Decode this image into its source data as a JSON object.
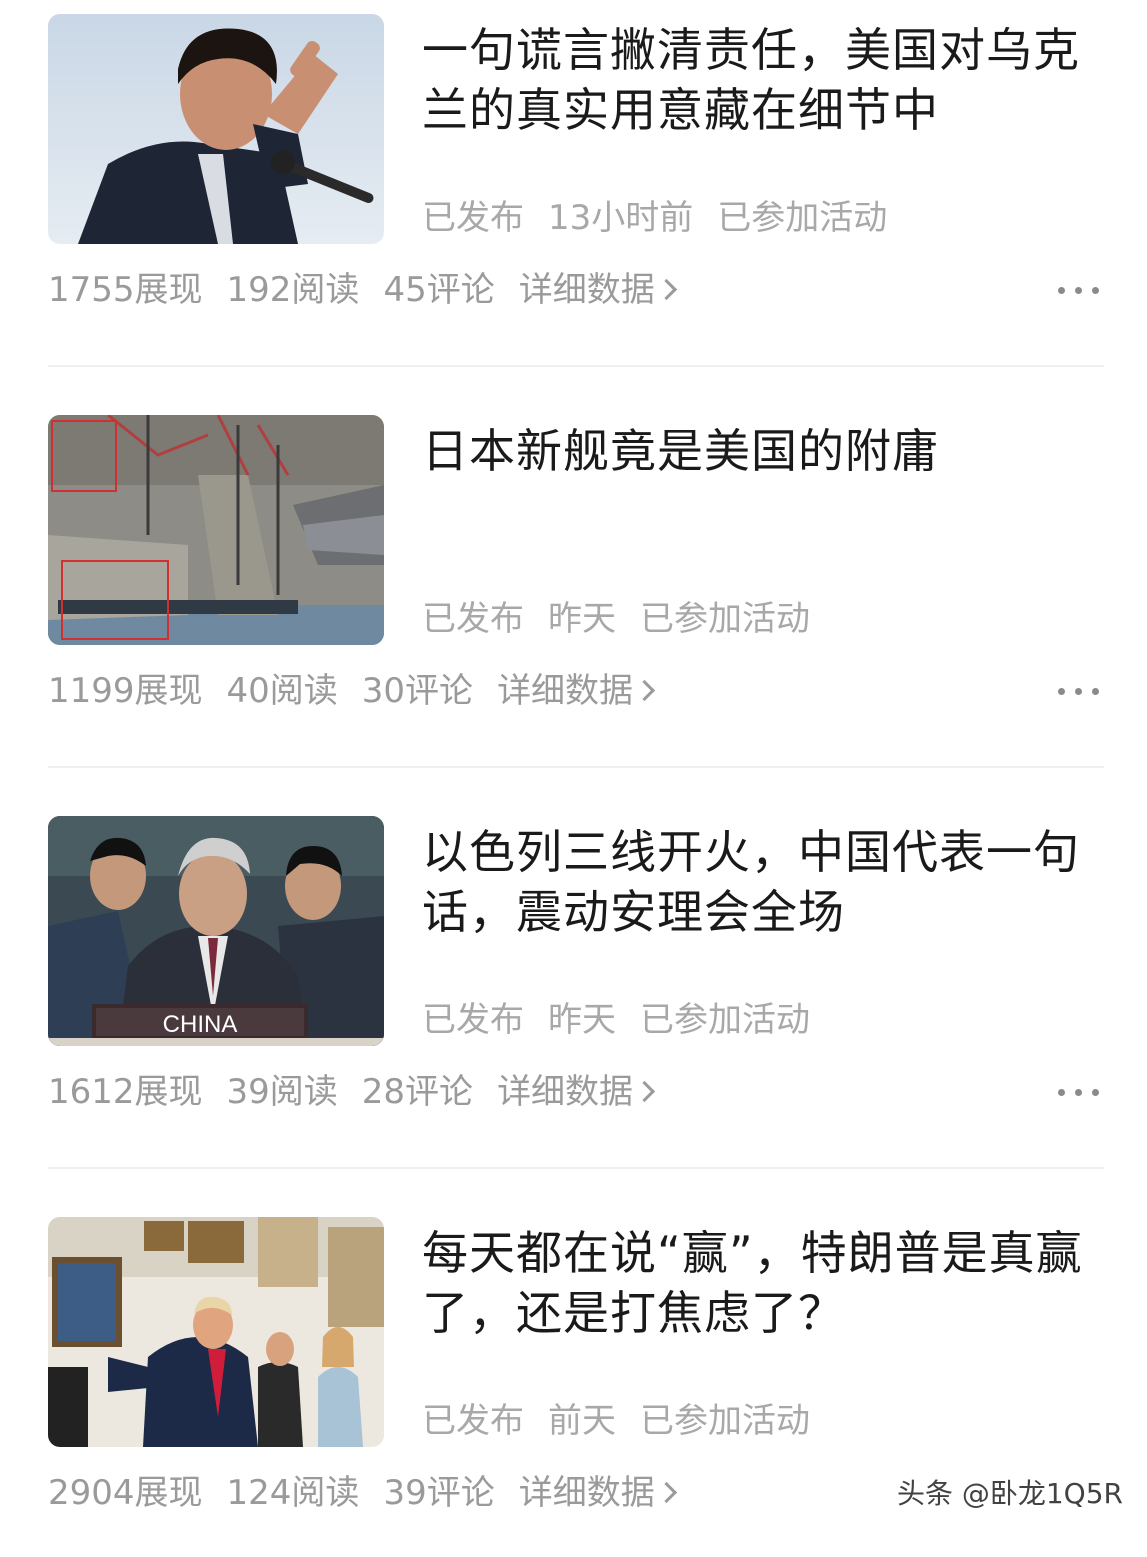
{
  "articles": [
    {
      "title": "一句谎言撇清责任，美国对乌克兰的真实用意藏在细节中",
      "status": "已发布",
      "time": "13小时前",
      "activity": "已参加活动",
      "impressions": "1755展现",
      "reads": "192阅读",
      "comments": "45评论",
      "details": "详细数据"
    },
    {
      "title": "日本新舰竟是美国的附庸",
      "status": "已发布",
      "time": "昨天",
      "activity": "已参加活动",
      "impressions": "1199展现",
      "reads": "40阅读",
      "comments": "30评论",
      "details": "详细数据"
    },
    {
      "title": "以色列三线开火，中国代表一句话，震动安理会全场",
      "status": "已发布",
      "time": "昨天",
      "activity": "已参加活动",
      "impressions": "1612展现",
      "reads": "39阅读",
      "comments": "28评论",
      "details": "详细数据",
      "image_caption": "CHINA"
    },
    {
      "title": "每天都在说“赢”，特朗普是真赢了，还是打焦虑了？",
      "status": "已发布",
      "time": "前天",
      "activity": "已参加活动",
      "impressions": "2904展现",
      "reads": "124阅读",
      "comments": "39评论",
      "details": "详细数据"
    }
  ],
  "watermark": "头条 @卧龙1Q5R",
  "colors": {
    "title": "#1a1a1a",
    "meta": "#a8a8a8",
    "stats": "#9a9a9a",
    "divider": "#efefef"
  },
  "icons": {
    "details_arrow": "chevron-right-icon",
    "more": "more-options-icon"
  }
}
